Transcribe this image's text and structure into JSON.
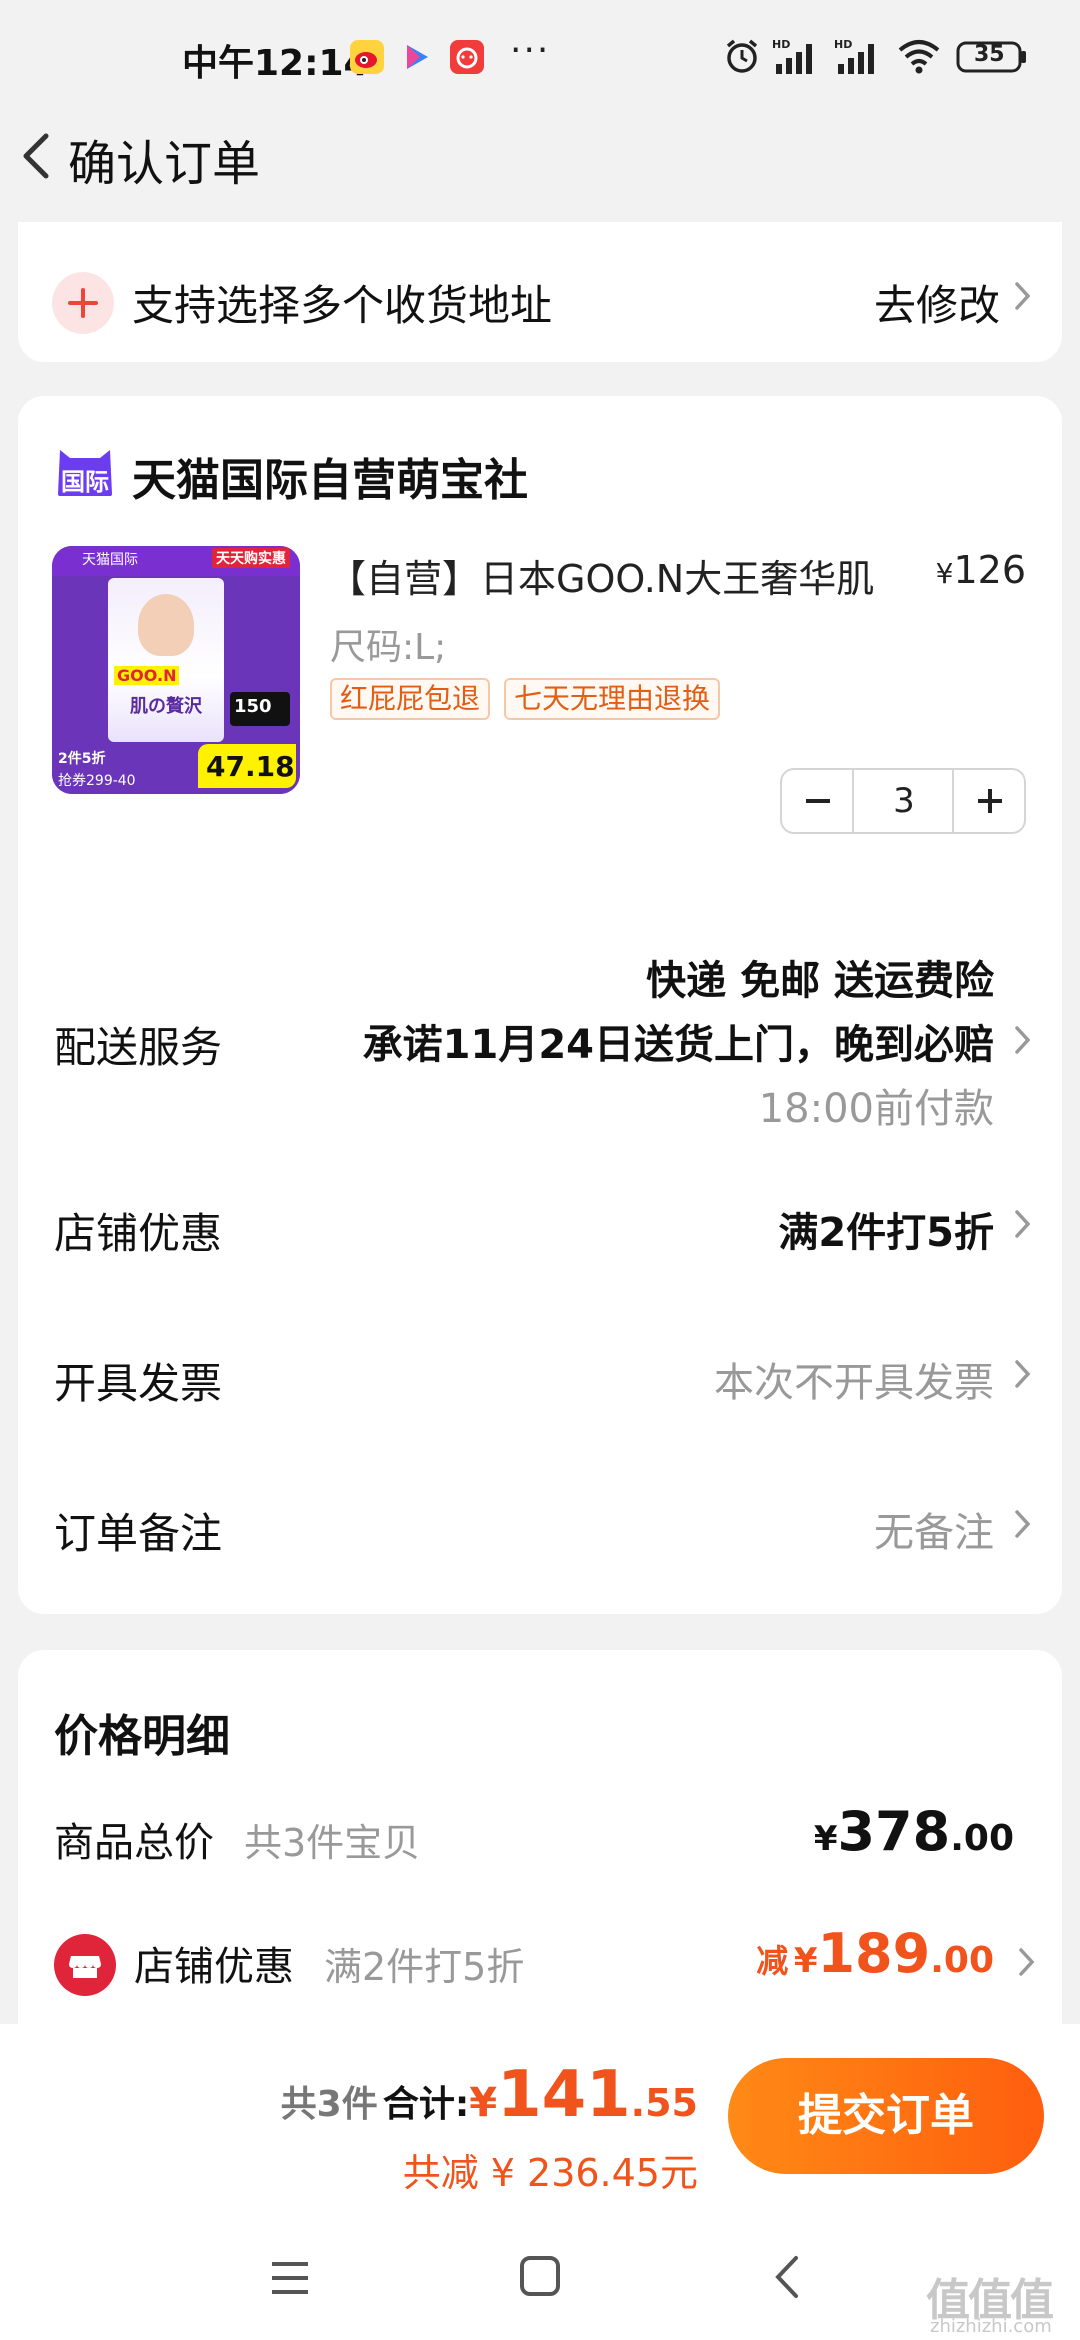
{
  "status_bar": {
    "time": "中午12:14",
    "dots": "···",
    "battery": "35",
    "hd1": "HD",
    "hd2": "HD"
  },
  "header": {
    "title": "确认订单"
  },
  "address": {
    "text": "支持选择多个收货地址",
    "edit_label": "去修改"
  },
  "store": {
    "icon_text": "国际",
    "name": "天猫国际自营萌宝社"
  },
  "product": {
    "title": "【自营】日本GOO.N大王奢华肌",
    "price_currency": "¥",
    "price": "126",
    "spec": "尺码:L;",
    "tags": [
      "红屁屁包退",
      "七天无理由退换"
    ],
    "quantity": "3",
    "image": {
      "banner_left": "天猫国际",
      "banner_right": "天天购实惠",
      "brand": "GOO.N",
      "series": "肌の贅沢",
      "count": "150",
      "promo": "2件5折",
      "promo_sub": "抢券299-40",
      "vip_price": "47.18"
    }
  },
  "delivery": {
    "label": "配送服务",
    "line1": "快递 免邮 送运费险",
    "line2": "承诺11月24日送货上门，晚到必赔",
    "line3": "18:00前付款"
  },
  "shop_discount_row": {
    "label": "店铺优惠",
    "value": "满2件打5折"
  },
  "invoice": {
    "label": "开具发票",
    "value": "本次不开具发票"
  },
  "remark": {
    "label": "订单备注",
    "value": "无备注"
  },
  "price_detail": {
    "title": "价格明细",
    "total_label": "商品总价",
    "total_sub": "共3件宝贝",
    "total_currency": "¥",
    "total_int": "378",
    "total_dec": ".00",
    "discount_label": "店铺优惠",
    "discount_sub": "满2件打5折",
    "discount_prefix": "减",
    "discount_currency": "¥",
    "discount_int": "189",
    "discount_dec": ".00"
  },
  "bottom": {
    "count": "共3件",
    "sum_label": "合计:",
    "sum_currency": "¥",
    "sum_int": "141",
    "sum_dec": ".55",
    "saved": "共减 ¥ 236.45元",
    "submit": "提交订单"
  },
  "watermark": {
    "text": "值值值",
    "sub": "zhizhizhi.com"
  },
  "colors": {
    "accent": "#f0531c",
    "button_start": "#ff8a16",
    "button_end": "#ff5e0e",
    "tmall_purple": "#6b3cf0",
    "shop_red": "#e0243a"
  }
}
